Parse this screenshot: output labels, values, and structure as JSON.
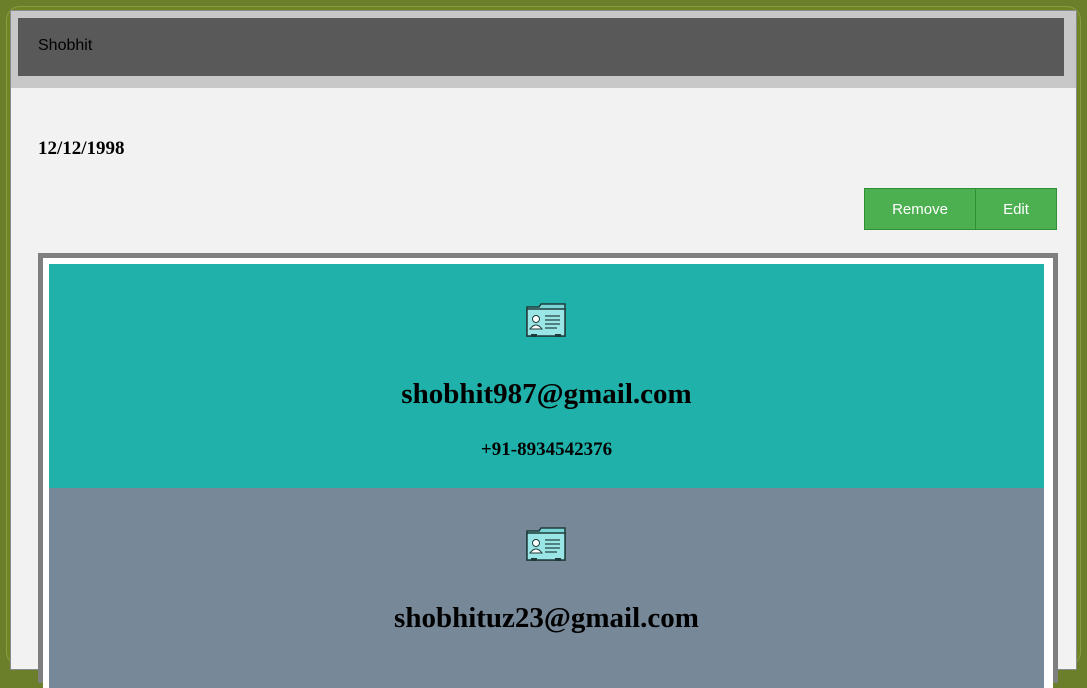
{
  "header": {
    "title": "Shobhit"
  },
  "profile": {
    "dob": "12/12/1998"
  },
  "actions": {
    "remove_label": "Remove",
    "edit_label": "Edit"
  },
  "contacts": [
    {
      "email": "shobhit987@gmail.com",
      "phone": "+91-8934542376",
      "icon": "contact-card-icon",
      "color": "#20b2aa"
    },
    {
      "email": "shobhituz23@gmail.com",
      "phone": "",
      "icon": "contact-card-icon",
      "color": "#778899"
    }
  ],
  "colors": {
    "header_bg": "#595959",
    "button_bg": "#4caf50",
    "page_bg": "#f2f2f2"
  }
}
